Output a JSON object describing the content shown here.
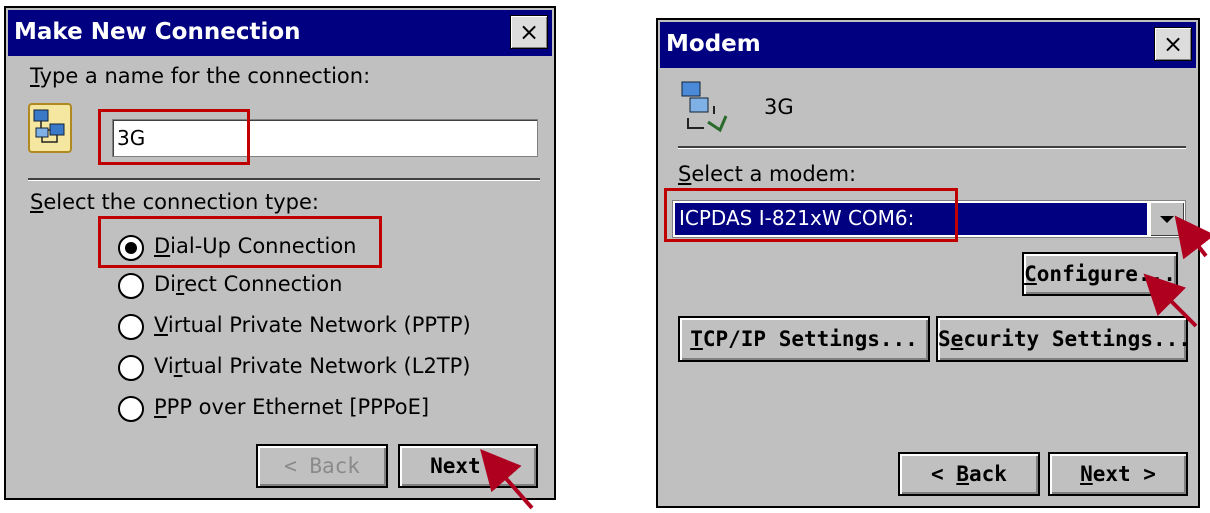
{
  "make_new_connection": {
    "title": "Make New Connection",
    "close_label": "×",
    "name_prompt": "Type a name for the connection:",
    "name_value": "3G",
    "type_prompt": "Select the connection type:",
    "options": [
      {
        "label": "Dial-Up Connection",
        "selected": true
      },
      {
        "label": "Direct Connection",
        "selected": false
      },
      {
        "label": "Virtual Private Network (PPTP)",
        "selected": false
      },
      {
        "label": "Virtual Private Network (L2TP)",
        "selected": false
      },
      {
        "label": "PPP over Ethernet [PPPoE]",
        "selected": false
      }
    ],
    "back_label": "< Back",
    "next_label": "Next >"
  },
  "modem": {
    "title": "Modem",
    "close_label": "×",
    "connection_name": "3G",
    "select_prompt": "Select a modem:",
    "selected_modem": "ICPDAS I-821xW COM6:",
    "configure_label": "Configure...",
    "tcpip_label": "TCP/IP Settings...",
    "security_label": "Security Settings...",
    "back_label": "< Back",
    "next_label": "Next >"
  },
  "colors": {
    "titlebar": "#000080",
    "dialog_bg": "#c0c0c0",
    "highlight_box": "#c00000",
    "arrow": "#b00020"
  }
}
